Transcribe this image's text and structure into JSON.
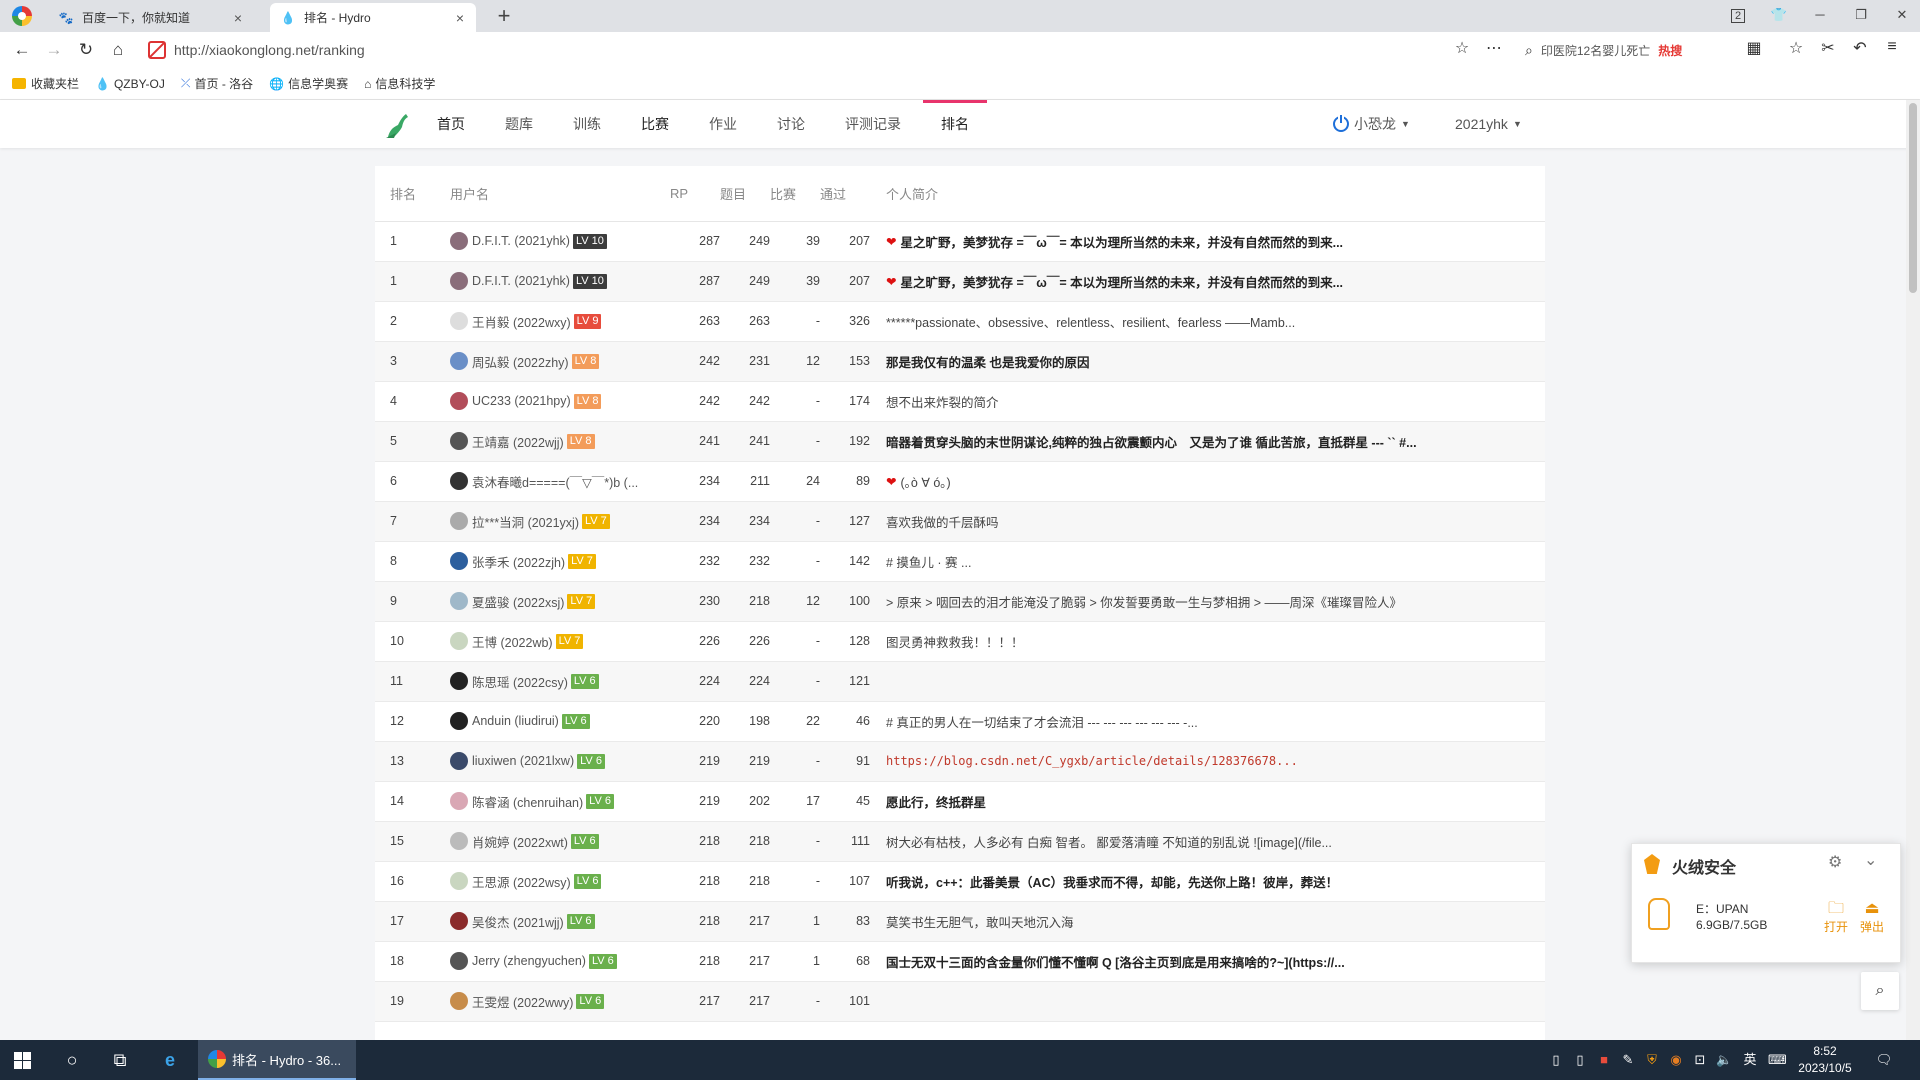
{
  "browser": {
    "tabs": [
      {
        "title": "百度一下，你就知道",
        "close": "×"
      },
      {
        "title": "排名 - Hydro",
        "close": "×"
      }
    ],
    "new_tab": "+",
    "url": "http://xiaokonglong.net/ranking",
    "search_text": "印医院12名婴儿死亡",
    "hot_label": "热搜",
    "bookmarks": [
      {
        "label": "收藏夹栏",
        "icon": "folder-icon"
      },
      {
        "label": "QZBY-OJ",
        "icon": "drop-icon"
      },
      {
        "label": "首页 - 洛谷",
        "icon": "luogu-icon"
      },
      {
        "label": "信息学奥赛",
        "icon": "globe-icon"
      },
      {
        "label": "信息科技学",
        "icon": "home-icon"
      }
    ],
    "window_badge": "2"
  },
  "site": {
    "nav": [
      "首页",
      "题库",
      "训练",
      "比赛",
      "作业",
      "讨论",
      "评测记录",
      "排名"
    ],
    "user_menu": "小恐龙",
    "account": "2021yhk"
  },
  "table": {
    "headers": {
      "rank": "排名",
      "user": "用户名",
      "rp": "RP",
      "solved": "题目",
      "contest": "比赛",
      "ac": "通过",
      "bio": "个人简介"
    },
    "rows": [
      {
        "rank": "1",
        "user": "D.F.I.T. (2021yhk)",
        "lv": "LV 10",
        "lv_color": "#3c3c3c",
        "rp": "287",
        "solved": "249",
        "contest": "39",
        "ac": "207",
        "bio": "星之旷野，美梦犹存 =￣ω￣= 本以为理所当然的未来，并没有自然而然的到来...",
        "heart": true,
        "bold": true
      },
      {
        "rank": "1",
        "user": "D.F.I.T. (2021yhk)",
        "lv": "LV 10",
        "lv_color": "#3c3c3c",
        "rp": "287",
        "solved": "249",
        "contest": "39",
        "ac": "207",
        "bio": "星之旷野，美梦犹存 =￣ω￣= 本以为理所当然的未来，并没有自然而然的到来...",
        "heart": true,
        "bold": true
      },
      {
        "rank": "2",
        "user": "王肖毅 (2022wxy)",
        "lv": "LV 9",
        "lv_color": "#e74c3c",
        "rp": "263",
        "solved": "263",
        "contest": "-",
        "ac": "326",
        "bio": "******passionate、obsessive、relentless、resilient、fearless ——Mamb...",
        "heart": false,
        "bold": false
      },
      {
        "rank": "3",
        "user": "周弘毅 (2022zhy)",
        "lv": "LV 8",
        "lv_color": "#f39c5a",
        "rp": "242",
        "solved": "231",
        "contest": "12",
        "ac": "153",
        "bio": "那是我仅有的温柔 也是我爱你的原因",
        "heart": false,
        "bold": true
      },
      {
        "rank": "4",
        "user": "UC233 (2021hpy)",
        "lv": "LV 8",
        "lv_color": "#f39c5a",
        "rp": "242",
        "solved": "242",
        "contest": "-",
        "ac": "174",
        "bio": "想不出来炸裂的简介",
        "heart": false,
        "bold": false
      },
      {
        "rank": "5",
        "user": "王靖嘉 (2022wjj)",
        "lv": "LV 8",
        "lv_color": "#f39c5a",
        "rp": "241",
        "solved": "241",
        "contest": "-",
        "ac": "192",
        "bio": "暗器着贯穿头脑的末世阴谋论,纯粹的独占欲震颤内心　又是为了谁 循此苦旅，直抵群星 --- `` #...",
        "heart": false,
        "bold": true
      },
      {
        "rank": "6",
        "user": "袁沐春曦d=====(￣▽￣*)b (...",
        "lv": "",
        "lv_color": "",
        "rp": "234",
        "solved": "211",
        "contest": "24",
        "ac": "89",
        "bio": "(｡ò ∀ ó｡)",
        "heart": true,
        "bold": false
      },
      {
        "rank": "7",
        "user": "拉***当洞 (2021yxj)",
        "lv": "LV 7",
        "lv_color": "#f0b400",
        "rp": "234",
        "solved": "234",
        "contest": "-",
        "ac": "127",
        "bio": "喜欢我做的千层酥吗",
        "heart": false,
        "bold": false
      },
      {
        "rank": "8",
        "user": "张季禾 (2022zjh)",
        "lv": "LV 7",
        "lv_color": "#f0b400",
        "rp": "232",
        "solved": "232",
        "contest": "-",
        "ac": "142",
        "bio": "# 摸鱼儿 · 赛 ...",
        "heart": false,
        "bold": false
      },
      {
        "rank": "9",
        "user": "夏盛骏 (2022xsj)",
        "lv": "LV 7",
        "lv_color": "#f0b400",
        "rp": "230",
        "solved": "218",
        "contest": "12",
        "ac": "100",
        "bio": "> 原来 > 咽回去的泪才能淹没了脆弱 > 你发誓要勇敢一生与梦相拥 > ——周深《璀璨冒险人》",
        "heart": false,
        "bold": false
      },
      {
        "rank": "10",
        "user": "王博 (2022wb)",
        "lv": "LV 7",
        "lv_color": "#f0b400",
        "rp": "226",
        "solved": "226",
        "contest": "-",
        "ac": "128",
        "bio": "图灵勇神救救我！！！！",
        "heart": false,
        "bold": false
      },
      {
        "rank": "11",
        "user": "陈思瑶 (2022csy)",
        "lv": "LV 6",
        "lv_color": "#6ab04c",
        "rp": "224",
        "solved": "224",
        "contest": "-",
        "ac": "121",
        "bio": "",
        "heart": false,
        "bold": false
      },
      {
        "rank": "12",
        "user": "Anduin (liudirui)",
        "lv": "LV 6",
        "lv_color": "#6ab04c",
        "rp": "220",
        "solved": "198",
        "contest": "22",
        "ac": "46",
        "bio": "# 真正的男人在一切结束了才会流泪 --- --- --- --- --- --- -...",
        "heart": false,
        "bold": false
      },
      {
        "rank": "13",
        "user": "liuxiwen (2021lxw)",
        "lv": "LV 6",
        "lv_color": "#6ab04c",
        "rp": "219",
        "solved": "219",
        "contest": "-",
        "ac": "91",
        "bio": "https://blog.csdn.net/C_ygxb/article/details/128376678...",
        "heart": false,
        "bold": false,
        "link": true
      },
      {
        "rank": "14",
        "user": "陈睿涵 (chenruihan)",
        "lv": "LV 6",
        "lv_color": "#6ab04c",
        "rp": "219",
        "solved": "202",
        "contest": "17",
        "ac": "45",
        "bio": "愿此行，终抵群星",
        "heart": false,
        "bold": true
      },
      {
        "rank": "15",
        "user": "肖婉婷 (2022xwt)",
        "lv": "LV 6",
        "lv_color": "#6ab04c",
        "rp": "218",
        "solved": "218",
        "contest": "-",
        "ac": "111",
        "bio": "树大必有枯枝，人多必有 白痴 智者。 鄙爱落清瞳 不知道的别乱说 ![image](/file...",
        "heart": false,
        "bold": false
      },
      {
        "rank": "16",
        "user": "王思源 (2022wsy)",
        "lv": "LV 6",
        "lv_color": "#6ab04c",
        "rp": "218",
        "solved": "218",
        "contest": "-",
        "ac": "107",
        "bio": "听我说，c++：此番美景（AC）我垂求而不得，却能，先送你上路！彼岸，葬送！",
        "heart": false,
        "bold": true
      },
      {
        "rank": "17",
        "user": "吴俊杰 (2021wjj)",
        "lv": "LV 6",
        "lv_color": "#6ab04c",
        "rp": "218",
        "solved": "217",
        "contest": "1",
        "ac": "83",
        "bio": "莫笑书生无胆气，敢叫天地沉入海",
        "heart": false,
        "bold": false
      },
      {
        "rank": "18",
        "user": "Jerry (zhengyuchen)",
        "lv": "LV 6",
        "lv_color": "#6ab04c",
        "rp": "218",
        "solved": "217",
        "contest": "1",
        "ac": "68",
        "bio": "国士无双十三面的含金量你们懂不懂啊 Q [洛谷主页到底是用来搞啥的?~](https://...",
        "heart": false,
        "bold": true
      },
      {
        "rank": "19",
        "user": "王雯煜 (2022wwy)",
        "lv": "LV 6",
        "lv_color": "#6ab04c",
        "rp": "217",
        "solved": "217",
        "contest": "-",
        "ac": "101",
        "bio": "",
        "heart": false,
        "bold": false
      }
    ]
  },
  "popup": {
    "title": "火绒安全",
    "drive_label": "E：UPAN",
    "drive_size": "6.9GB/7.5GB",
    "open": "打开",
    "eject": "弹出"
  },
  "taskbar": {
    "app_title": "排名 - Hydro - 36...",
    "ime": "英",
    "time": "8:52",
    "date": "2023/10/5"
  }
}
